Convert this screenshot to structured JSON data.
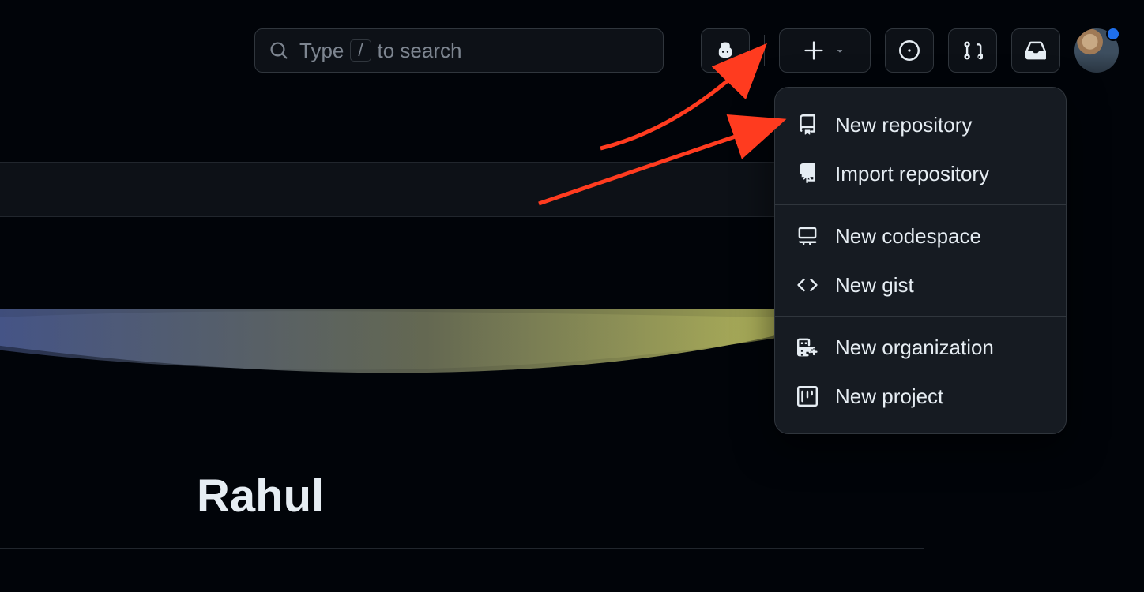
{
  "search": {
    "placeholder_prefix": "Type ",
    "placeholder_suffix": " to search",
    "kbd": "/"
  },
  "create_menu": {
    "items": [
      {
        "icon": "repo-icon",
        "label": "New repository"
      },
      {
        "icon": "repo-push-icon",
        "label": "Import repository"
      },
      {
        "icon": "codespace-icon",
        "label": "New codespace"
      },
      {
        "icon": "code-icon",
        "label": "New gist"
      },
      {
        "icon": "org-icon",
        "label": "New organization"
      },
      {
        "icon": "project-icon",
        "label": "New project"
      }
    ]
  },
  "user": {
    "display_name": "Rahul",
    "has_notification": true
  },
  "icons": {
    "copilot": "copilot-icon",
    "plus": "plus-icon",
    "issues": "issue-opened-icon",
    "pr": "pull-request-icon",
    "inbox": "inbox-icon"
  }
}
